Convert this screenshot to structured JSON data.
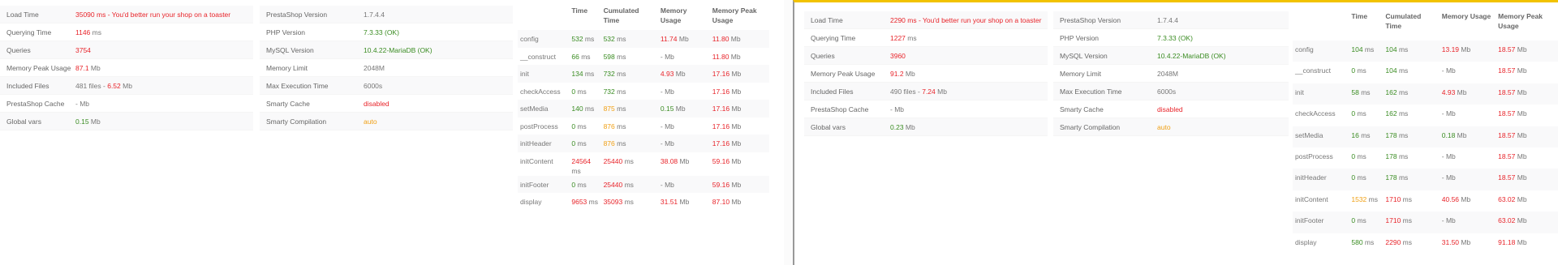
{
  "panels": [
    {
      "summary": [
        {
          "label": "Load Time",
          "parts": [
            {
              "t": "35090",
              "c": "red"
            },
            {
              "t": " ms - You'd better run your shop on a toaster",
              "c": "red"
            }
          ]
        },
        {
          "label": "Querying Time",
          "parts": [
            {
              "t": "1146",
              "c": "red"
            },
            {
              "t": " ms",
              "c": "grey"
            }
          ]
        },
        {
          "label": "Queries",
          "parts": [
            {
              "t": "3754",
              "c": "red"
            }
          ]
        },
        {
          "label": "Memory Peak Usage",
          "parts": [
            {
              "t": "87.1",
              "c": "red"
            },
            {
              "t": " Mb",
              "c": "grey"
            }
          ]
        },
        {
          "label": "Included Files",
          "parts": [
            {
              "t": "481 files - ",
              "c": "grey"
            },
            {
              "t": "6.52",
              "c": "red"
            },
            {
              "t": " Mb",
              "c": "grey"
            }
          ]
        },
        {
          "label": "PrestaShop Cache",
          "parts": [
            {
              "t": "- Mb",
              "c": "grey"
            }
          ]
        },
        {
          "label": "Global vars",
          "parts": [
            {
              "t": "0.15",
              "c": "green"
            },
            {
              "t": " Mb",
              "c": "grey"
            }
          ]
        }
      ],
      "config": [
        {
          "label": "PrestaShop Version",
          "parts": [
            {
              "t": "1.7.4.4",
              "c": "grey"
            }
          ]
        },
        {
          "label": "PHP Version",
          "parts": [
            {
              "t": "7.3.33 (OK)",
              "c": "green"
            }
          ]
        },
        {
          "label": "MySQL Version",
          "parts": [
            {
              "t": "10.4.22-MariaDB (OK)",
              "c": "green"
            }
          ]
        },
        {
          "label": "Memory Limit",
          "parts": [
            {
              "t": "2048M",
              "c": "grey"
            }
          ]
        },
        {
          "label": "Max Execution Time",
          "parts": [
            {
              "t": "6000s",
              "c": "grey"
            }
          ]
        },
        {
          "label": "Smarty Cache",
          "parts": [
            {
              "t": "disabled",
              "c": "red"
            }
          ]
        },
        {
          "label": "Smarty Compilation",
          "parts": [
            {
              "t": "auto",
              "c": "orange"
            }
          ]
        }
      ],
      "hooks": {
        "headers": [
          "",
          "Time",
          "Cumulated Time",
          "Memory Usage",
          "Memory Peak Usage"
        ],
        "rows": [
          {
            "name": "config",
            "time": {
              "t": "532",
              "c": "green"
            },
            "cum": {
              "t": "532",
              "c": "green"
            },
            "mem": {
              "t": "11.74",
              "c": "red"
            },
            "peak": {
              "t": "11.80",
              "c": "red"
            }
          },
          {
            "name": "__construct",
            "time": {
              "t": "66",
              "c": "green"
            },
            "cum": {
              "t": "598",
              "c": "green"
            },
            "mem": {
              "t": "-",
              "c": "grey"
            },
            "peak": {
              "t": "11.80",
              "c": "red"
            }
          },
          {
            "name": "init",
            "time": {
              "t": "134",
              "c": "green"
            },
            "cum": {
              "t": "732",
              "c": "green"
            },
            "mem": {
              "t": "4.93",
              "c": "red"
            },
            "peak": {
              "t": "17.16",
              "c": "red"
            }
          },
          {
            "name": "checkAccess",
            "time": {
              "t": "0",
              "c": "green"
            },
            "cum": {
              "t": "732",
              "c": "green"
            },
            "mem": {
              "t": "-",
              "c": "grey"
            },
            "peak": {
              "t": "17.16",
              "c": "red"
            }
          },
          {
            "name": "setMedia",
            "time": {
              "t": "140",
              "c": "green"
            },
            "cum": {
              "t": "875",
              "c": "orange"
            },
            "mem": {
              "t": "0.15",
              "c": "green"
            },
            "peak": {
              "t": "17.16",
              "c": "red"
            }
          },
          {
            "name": "postProcess",
            "time": {
              "t": "0",
              "c": "green"
            },
            "cum": {
              "t": "876",
              "c": "orange"
            },
            "mem": {
              "t": "-",
              "c": "grey"
            },
            "peak": {
              "t": "17.16",
              "c": "red"
            }
          },
          {
            "name": "initHeader",
            "time": {
              "t": "0",
              "c": "green"
            },
            "cum": {
              "t": "876",
              "c": "orange"
            },
            "mem": {
              "t": "-",
              "c": "grey"
            },
            "peak": {
              "t": "17.16",
              "c": "red"
            }
          },
          {
            "name": "initContent",
            "time": {
              "t": "24564",
              "c": "red"
            },
            "cum": {
              "t": "25440",
              "c": "red"
            },
            "mem": {
              "t": "38.08",
              "c": "red"
            },
            "peak": {
              "t": "59.16",
              "c": "red"
            }
          },
          {
            "name": "initFooter",
            "time": {
              "t": "0",
              "c": "green"
            },
            "cum": {
              "t": "25440",
              "c": "red"
            },
            "mem": {
              "t": "-",
              "c": "grey"
            },
            "peak": {
              "t": "59.16",
              "c": "red"
            }
          },
          {
            "name": "display",
            "time": {
              "t": "9653",
              "c": "red"
            },
            "cum": {
              "t": "35093",
              "c": "red"
            },
            "mem": {
              "t": "31.51",
              "c": "red"
            },
            "peak": {
              "t": "87.10",
              "c": "red"
            }
          }
        ]
      }
    },
    {
      "summary": [
        {
          "label": "Load Time",
          "parts": [
            {
              "t": "2290",
              "c": "red"
            },
            {
              "t": " ms - You'd better run your shop on a toaster",
              "c": "red"
            }
          ]
        },
        {
          "label": "Querying Time",
          "parts": [
            {
              "t": "1227",
              "c": "red"
            },
            {
              "t": " ms",
              "c": "grey"
            }
          ]
        },
        {
          "label": "Queries",
          "parts": [
            {
              "t": "3960",
              "c": "red"
            }
          ]
        },
        {
          "label": "Memory Peak Usage",
          "parts": [
            {
              "t": "91.2",
              "c": "red"
            },
            {
              "t": " Mb",
              "c": "grey"
            }
          ]
        },
        {
          "label": "Included Files",
          "parts": [
            {
              "t": "490 files - ",
              "c": "grey"
            },
            {
              "t": "7.24",
              "c": "red"
            },
            {
              "t": " Mb",
              "c": "grey"
            }
          ]
        },
        {
          "label": "PrestaShop Cache",
          "parts": [
            {
              "t": "- Mb",
              "c": "grey"
            }
          ]
        },
        {
          "label": "Global vars",
          "parts": [
            {
              "t": "0.23",
              "c": "green"
            },
            {
              "t": " Mb",
              "c": "grey"
            }
          ]
        }
      ],
      "config": [
        {
          "label": "PrestaShop Version",
          "parts": [
            {
              "t": "1.7.4.4",
              "c": "grey"
            }
          ]
        },
        {
          "label": "PHP Version",
          "parts": [
            {
              "t": "7.3.33 (OK)",
              "c": "green"
            }
          ]
        },
        {
          "label": "MySQL Version",
          "parts": [
            {
              "t": "10.4.22-MariaDB (OK)",
              "c": "green"
            }
          ]
        },
        {
          "label": "Memory Limit",
          "parts": [
            {
              "t": "2048M",
              "c": "grey"
            }
          ]
        },
        {
          "label": "Max Execution Time",
          "parts": [
            {
              "t": "6000s",
              "c": "grey"
            }
          ]
        },
        {
          "label": "Smarty Cache",
          "parts": [
            {
              "t": "disabled",
              "c": "red"
            }
          ]
        },
        {
          "label": "Smarty Compilation",
          "parts": [
            {
              "t": "auto",
              "c": "orange"
            }
          ]
        }
      ],
      "hooks": {
        "headers": [
          "",
          "Time",
          "Cumulated Time",
          "Memory Usage",
          "Memory Peak Usage"
        ],
        "rows": [
          {
            "name": "config",
            "time": {
              "t": "104",
              "c": "green"
            },
            "cum": {
              "t": "104",
              "c": "green"
            },
            "mem": {
              "t": "13.19",
              "c": "red"
            },
            "peak": {
              "t": "18.57",
              "c": "red"
            }
          },
          {
            "name": "__construct",
            "time": {
              "t": "0",
              "c": "green"
            },
            "cum": {
              "t": "104",
              "c": "green"
            },
            "mem": {
              "t": "-",
              "c": "grey"
            },
            "peak": {
              "t": "18.57",
              "c": "red"
            }
          },
          {
            "name": "init",
            "time": {
              "t": "58",
              "c": "green"
            },
            "cum": {
              "t": "162",
              "c": "green"
            },
            "mem": {
              "t": "4.93",
              "c": "red"
            },
            "peak": {
              "t": "18.57",
              "c": "red"
            }
          },
          {
            "name": "checkAccess",
            "time": {
              "t": "0",
              "c": "green"
            },
            "cum": {
              "t": "162",
              "c": "green"
            },
            "mem": {
              "t": "-",
              "c": "grey"
            },
            "peak": {
              "t": "18.57",
              "c": "red"
            }
          },
          {
            "name": "setMedia",
            "time": {
              "t": "16",
              "c": "green"
            },
            "cum": {
              "t": "178",
              "c": "green"
            },
            "mem": {
              "t": "0.18",
              "c": "green"
            },
            "peak": {
              "t": "18.57",
              "c": "red"
            }
          },
          {
            "name": "postProcess",
            "time": {
              "t": "0",
              "c": "green"
            },
            "cum": {
              "t": "178",
              "c": "green"
            },
            "mem": {
              "t": "-",
              "c": "grey"
            },
            "peak": {
              "t": "18.57",
              "c": "red"
            }
          },
          {
            "name": "initHeader",
            "time": {
              "t": "0",
              "c": "green"
            },
            "cum": {
              "t": "178",
              "c": "green"
            },
            "mem": {
              "t": "-",
              "c": "grey"
            },
            "peak": {
              "t": "18.57",
              "c": "red"
            }
          },
          {
            "name": "initContent",
            "time": {
              "t": "1532",
              "c": "orange"
            },
            "cum": {
              "t": "1710",
              "c": "red"
            },
            "mem": {
              "t": "40.56",
              "c": "red"
            },
            "peak": {
              "t": "63.02",
              "c": "red"
            }
          },
          {
            "name": "initFooter",
            "time": {
              "t": "0",
              "c": "green"
            },
            "cum": {
              "t": "1710",
              "c": "red"
            },
            "mem": {
              "t": "-",
              "c": "grey"
            },
            "peak": {
              "t": "63.02",
              "c": "red"
            }
          },
          {
            "name": "display",
            "time": {
              "t": "580",
              "c": "green"
            },
            "cum": {
              "t": "2290",
              "c": "red"
            },
            "mem": {
              "t": "31.50",
              "c": "red"
            },
            "peak": {
              "t": "91.18",
              "c": "red"
            }
          }
        ]
      }
    }
  ],
  "units": {
    "ms": " ms",
    "mb": " Mb"
  }
}
